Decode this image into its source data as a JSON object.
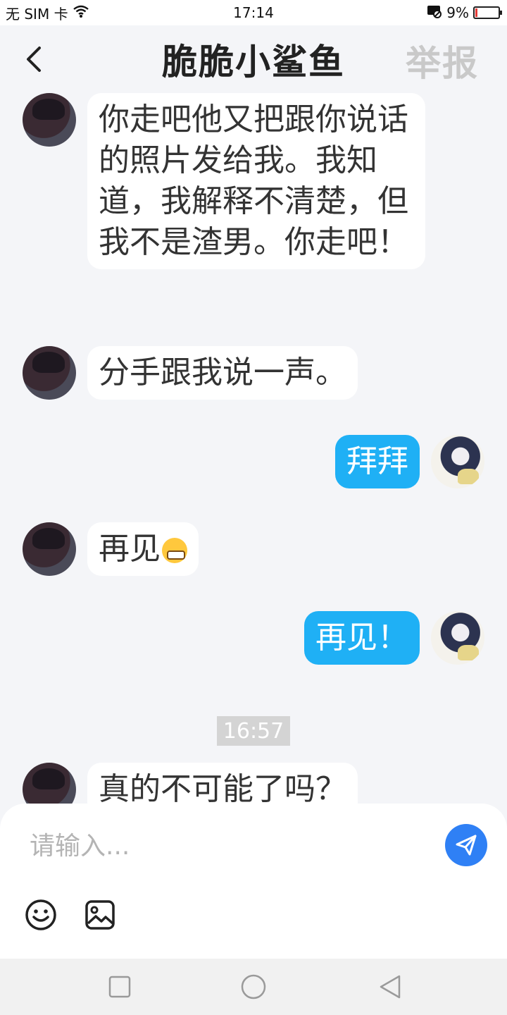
{
  "status_bar": {
    "carrier": "无 SIM 卡",
    "time": "17:14",
    "battery_percent": "9%",
    "battery_level": 0.09,
    "battery_color": "#e53935",
    "icons": [
      "wifi-icon",
      "data-saver-icon",
      "battery-icon"
    ]
  },
  "header": {
    "title": "脆脆小鲨鱼",
    "report_label": "举报",
    "back_icon": "chevron-left-icon"
  },
  "messages": [
    {
      "side": "left",
      "text": "你走吧他又把跟你说话的照片发给我。我知道，我解释不清楚，但我不是渣男。你走吧！"
    },
    {
      "side": "left",
      "text": "分手跟我说一声。"
    },
    {
      "side": "right",
      "text": "拜拜"
    },
    {
      "side": "left",
      "text": "再见",
      "emoji": "grimacing-face-emoji"
    },
    {
      "side": "right",
      "text": "再见！"
    },
    {
      "side": "left",
      "text": "真的不可能了吗？"
    }
  ],
  "time_divider": "16:57",
  "input": {
    "placeholder": "请输入...",
    "value": ""
  },
  "colors": {
    "my_bubble": "#1fb0f5",
    "send_button": "#2f80f5",
    "background": "#f4f5f8"
  }
}
